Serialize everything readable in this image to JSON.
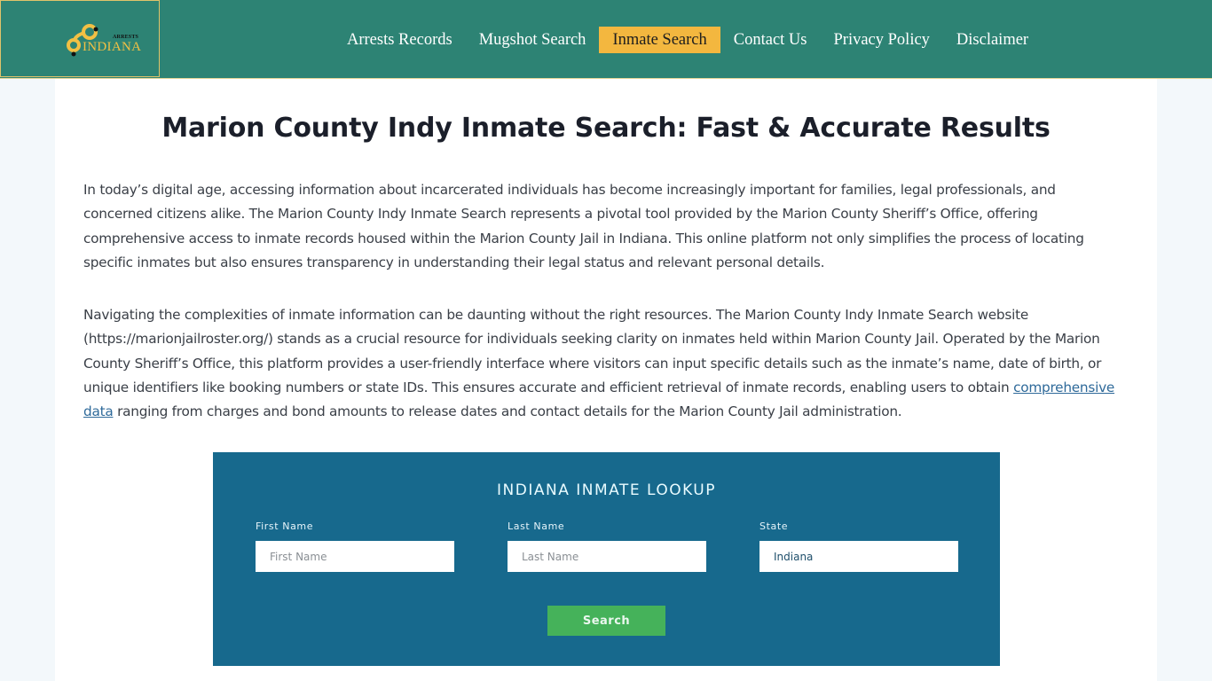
{
  "header": {
    "logo": {
      "top_text": "ARRESTS",
      "main_text": "INDIANA",
      "icon": "handcuffs-icon"
    },
    "nav": [
      {
        "label": "Arrests Records",
        "active": false
      },
      {
        "label": "Mugshot Search",
        "active": false
      },
      {
        "label": "Inmate Search",
        "active": true
      },
      {
        "label": "Contact Us",
        "active": false
      },
      {
        "label": "Privacy Policy",
        "active": false
      },
      {
        "label": "Disclaimer",
        "active": false
      }
    ]
  },
  "article": {
    "title": "Marion County Indy Inmate Search: Fast & Accurate Results",
    "paragraph1": "In today’s digital age, accessing information about incarcerated individuals has become increasingly important for families, legal professionals, and concerned citizens alike. The Marion County Indy Inmate Search represents a pivotal tool provided by the Marion County Sheriff’s Office, offering comprehensive access to inmate records housed within the Marion County Jail in Indiana. This online platform not only simplifies the process of locating specific inmates but also ensures transparency in understanding their legal status and relevant personal details.",
    "paragraph2_before_link": "Navigating the complexities of inmate information can be daunting without the right resources. The Marion County Indy Inmate Search website (https://marionjailroster.org/) stands as a crucial resource for individuals seeking clarity on inmates held within Marion County Jail. Operated by the Marion County Sheriff’s Office, this platform provides a user-friendly interface where visitors can input specific details such as the inmate’s name, date of birth, or unique identifiers like booking numbers or state IDs. This ensures accurate and efficient retrieval of inmate records, enabling users to obtain ",
    "paragraph2_link": "comprehensive data",
    "paragraph2_after_link": " ranging from charges and bond amounts to release dates and contact details for the Marion County Jail administration."
  },
  "lookup": {
    "title": "INDIANA INMATE LOOKUP",
    "first_name": {
      "label": "First Name",
      "placeholder": "First Name",
      "value": ""
    },
    "last_name": {
      "label": "Last Name",
      "placeholder": "Last Name",
      "value": ""
    },
    "state": {
      "label": "State",
      "value": "Indiana"
    },
    "search_label": "Search"
  },
  "colors": {
    "header_bg": "#2d8374",
    "nav_active_bg": "#f3b73f",
    "lookup_bg": "#17698d",
    "search_button": "#45b25a",
    "link": "#2f6a9a"
  }
}
